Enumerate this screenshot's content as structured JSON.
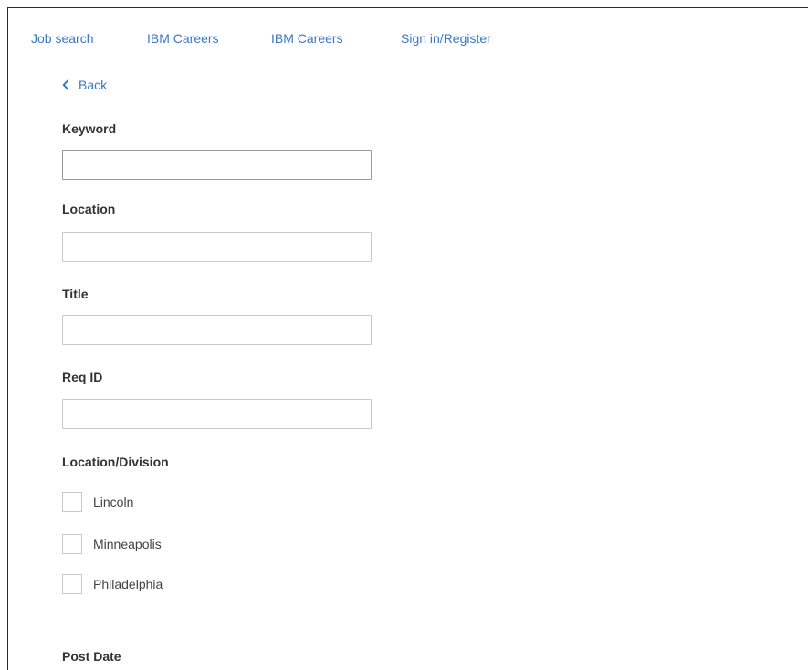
{
  "nav": {
    "links": [
      "Job search",
      "IBM Careers",
      "IBM Careers",
      "Sign in/Register"
    ]
  },
  "back": {
    "label": "Back"
  },
  "form": {
    "keyword": {
      "label": "Keyword",
      "value": ""
    },
    "location": {
      "label": "Location",
      "value": ""
    },
    "title": {
      "label": "Title",
      "value": ""
    },
    "req_id": {
      "label": "Req ID",
      "value": ""
    },
    "division": {
      "label": "Location/Division",
      "options": [
        "Lincoln",
        "Minneapolis",
        "Philadelphia"
      ]
    },
    "post_date": {
      "label": "Post Date"
    }
  },
  "colors": {
    "link": "#3a78c3",
    "text": "#333333",
    "border": "#c9c9c9"
  },
  "icons": {
    "back": "chevron-left-icon"
  }
}
